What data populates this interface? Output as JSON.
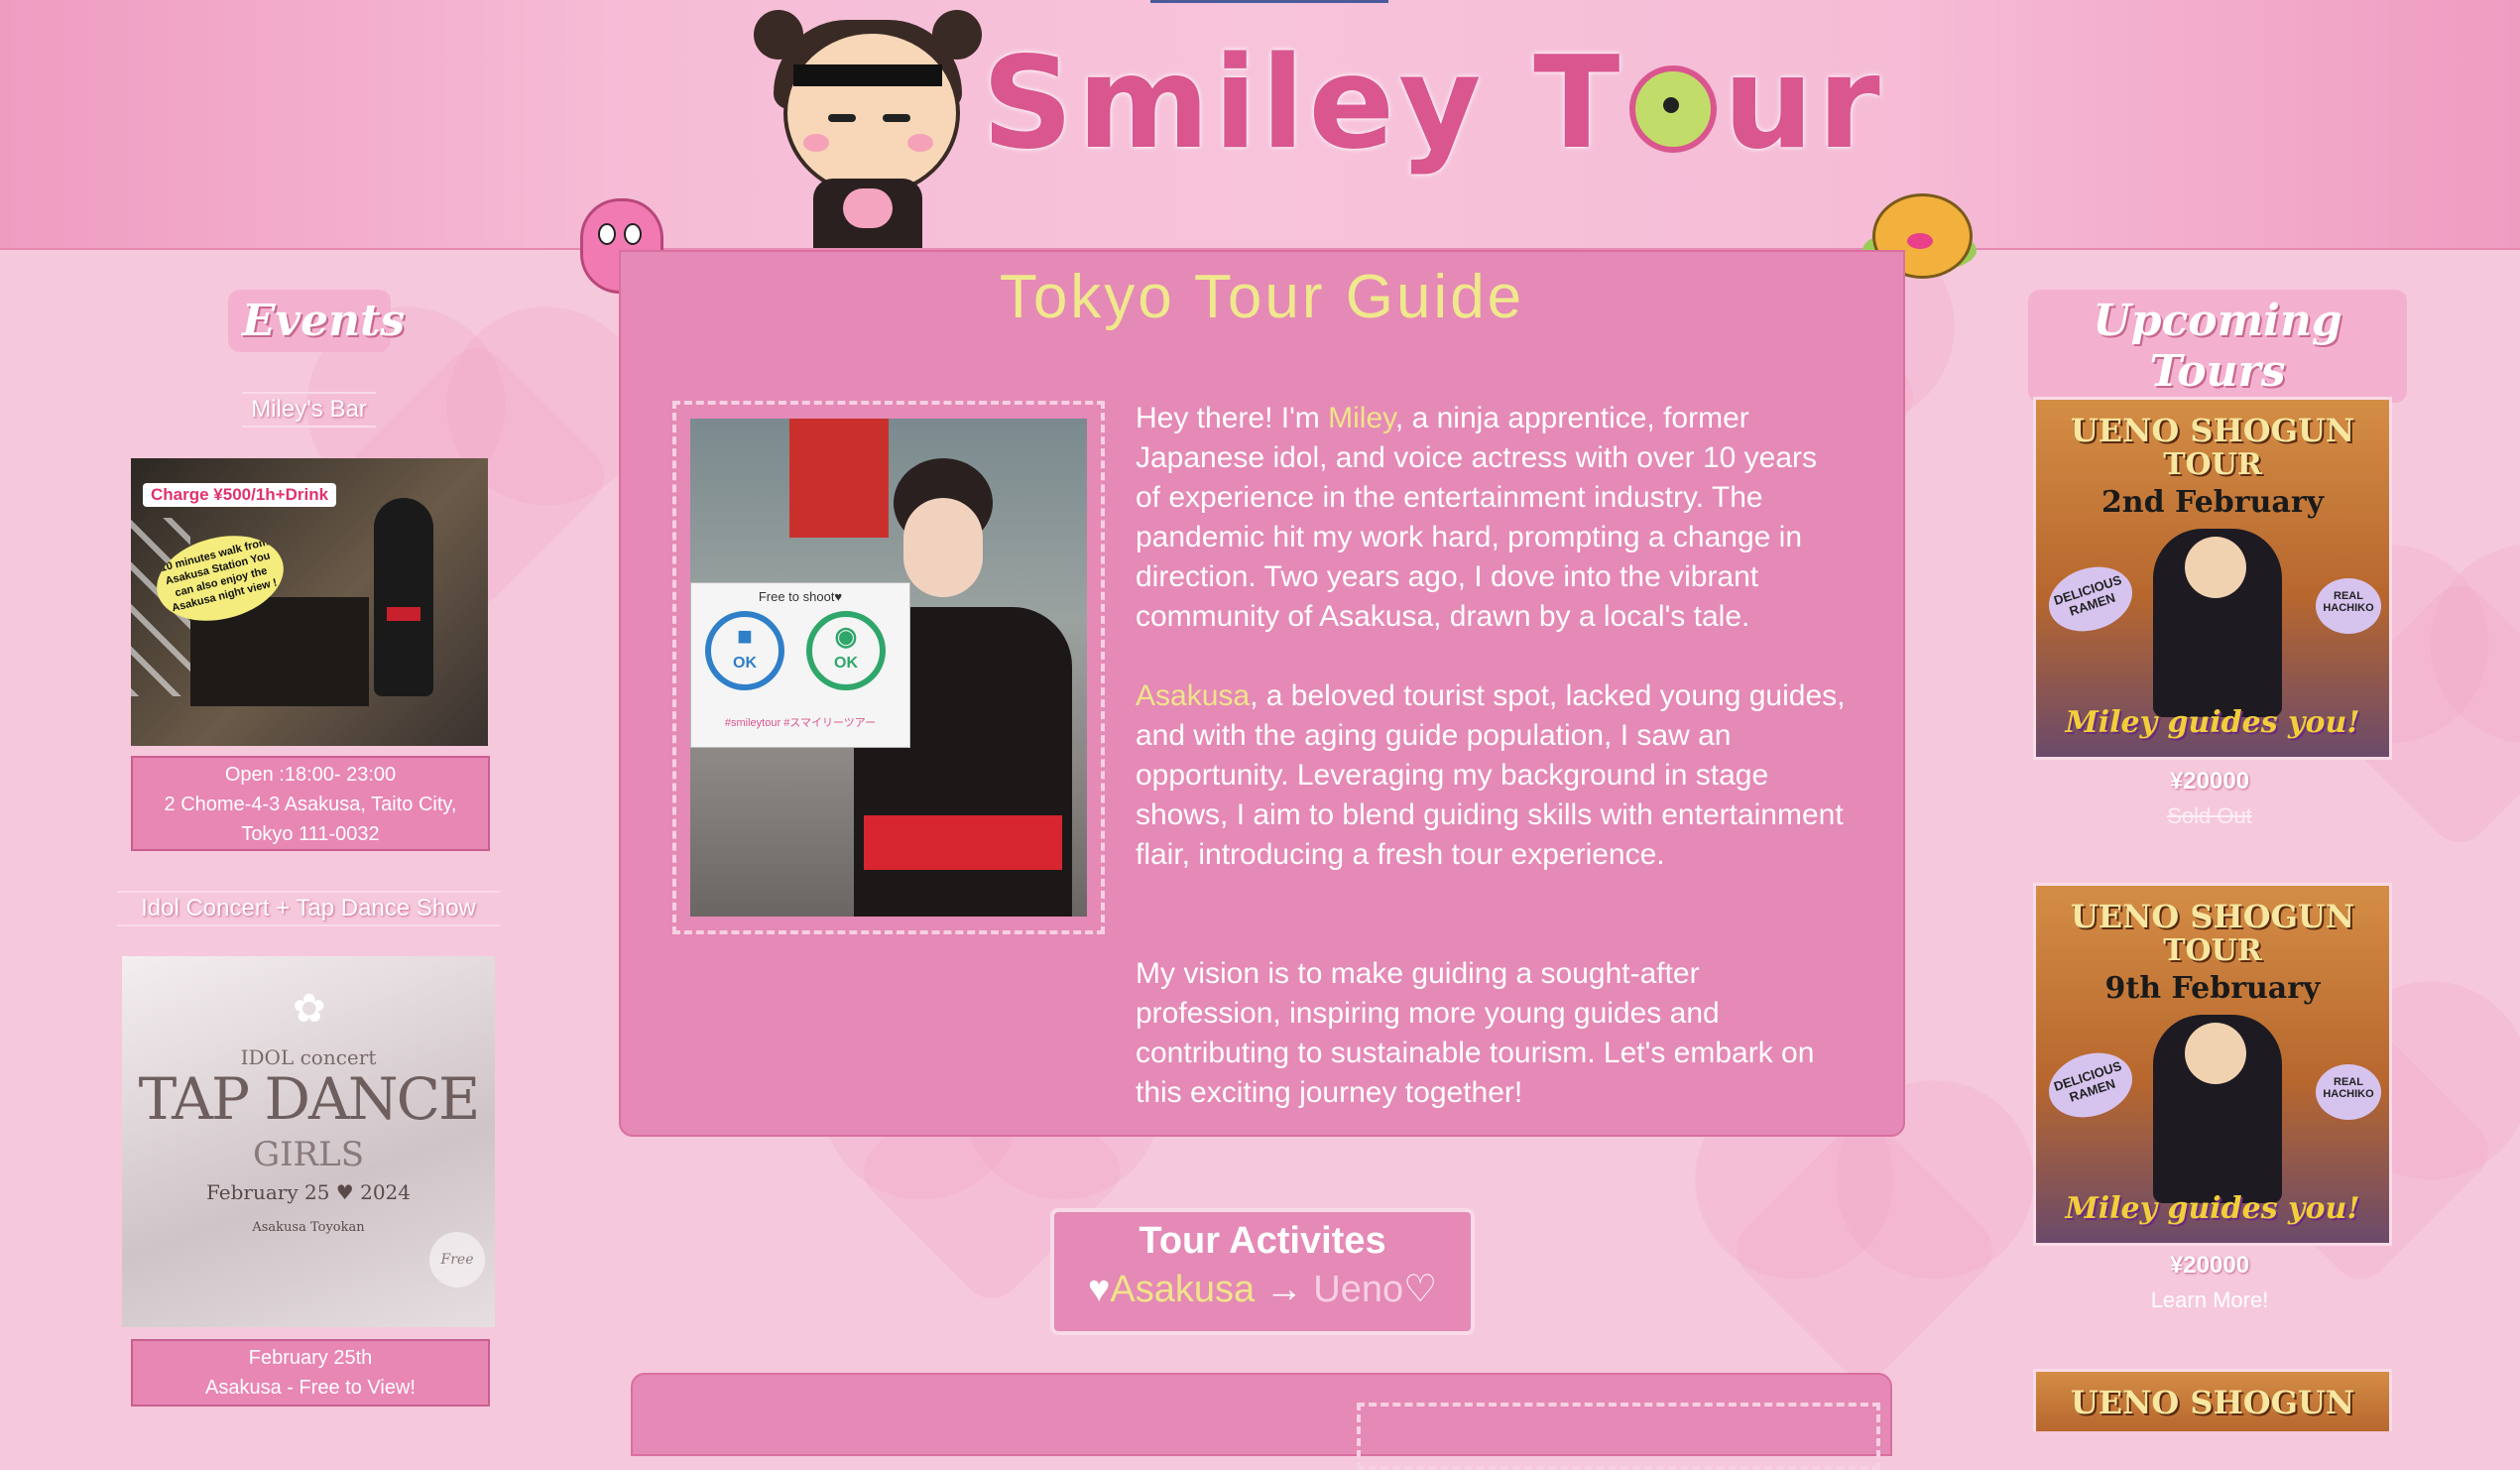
{
  "brand": {
    "title_left": "Smiley T",
    "title_right": "ur"
  },
  "events": {
    "heading": "Events",
    "items": [
      {
        "title": "Miley's Bar",
        "img_badge": "Charge ¥500/1h+Drink",
        "img_bubble": "10 minutes walk from Asakusa Station You can also enjoy the Asakusa night view !",
        "info_lines": [
          "Open :18:00- 23:00",
          "2 Chome-4-3 Asakusa, Taito City,",
          "Tokyo 111-0032"
        ]
      },
      {
        "title": "Idol Concert + Tap Dance Show",
        "img_line1": "IDOL concert",
        "img_line2": "TAP DANCE",
        "img_line3": "GIRLS",
        "img_date": "February 25 ♥ 2024",
        "img_venue": "Asakusa Toyokan",
        "img_stamp": "Free",
        "info_lines": [
          "February 25th",
          "Asakusa - Free to View!"
        ]
      }
    ]
  },
  "main": {
    "title": "Tokyo Tour Guide",
    "photo_sign_title": "Free to shoot♥",
    "photo_sign_ok": "OK",
    "photo_sign_tag": "#smileytour #スマイリーツアー",
    "p1": {
      "pre": "Hey there! I'm ",
      "name": "Miley",
      "post": ", a ninja apprentice, former Japanese idol, and voice actress with over 10 years of experience in the entertainment industry. The pandemic hit my work hard, prompting a change in direction. Two years ago, I dove into the vibrant community of Asakusa, drawn by a local's tale."
    },
    "p2": {
      "place": "Asakusa",
      "post": ", a beloved tourist spot, lacked young guides, and with the aging guide population, I saw an opportunity. Leveraging my background in stage shows, I aim to blend guiding skills with entertainment flair, introducing a fresh tour experience."
    },
    "p3": "My vision is to make guiding a sought-after profession, inspiring more young guides and contributing to sustainable tourism. Let's embark on this exciting journey together!"
  },
  "activities": {
    "title": "Tour Activites",
    "from": "Asakusa",
    "arrow": "→",
    "to": "Ueno"
  },
  "upcoming": {
    "heading": "Upcoming Tours",
    "tours": [
      {
        "line1": "UENO SHOGUN",
        "line2": "TOUR",
        "date": "2nd February",
        "bubble_left": "DELICIOUS RAMEN",
        "bubble_right": "REAL HACHIKO",
        "tagline": "Miley guides you!",
        "price": "¥20000",
        "status": "Sold Out"
      },
      {
        "line1": "UENO SHOGUN",
        "line2": "TOUR",
        "date": "9th February",
        "bubble_left": "DELICIOUS RAMEN",
        "bubble_right": "REAL HACHIKO",
        "tagline": "Miley guides you!",
        "price": "¥20000",
        "status": "Learn More!"
      },
      {
        "line1": "UENO SHOGUN"
      }
    ]
  },
  "colors": {
    "accent_pink": "#d9568f",
    "highlight_yellow": "#f0e48a",
    "card_pink": "#e589b6"
  }
}
